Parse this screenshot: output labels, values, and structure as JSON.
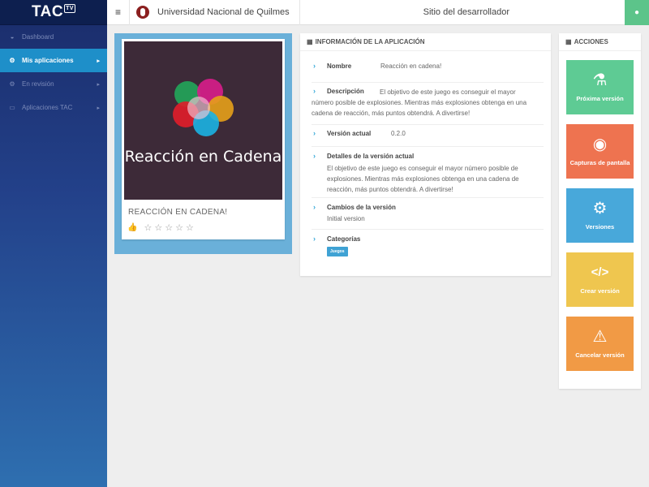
{
  "brand": {
    "name": "TAC",
    "badge": "TV"
  },
  "sidebar": {
    "items": [
      {
        "label": "Dashboard",
        "icon": "dashboard-icon",
        "glyph": "◒",
        "caret": ""
      },
      {
        "label": "Mis aplicaciones",
        "icon": "cogs-icon",
        "glyph": "⚙",
        "caret": "▸",
        "active": true
      },
      {
        "label": "En revisión",
        "icon": "cogs-icon",
        "glyph": "⚙",
        "caret": "▸"
      },
      {
        "label": "Aplicaciones TAC",
        "icon": "tv-icon",
        "glyph": "▭",
        "caret": "▸"
      }
    ]
  },
  "header": {
    "menu_glyph": "≡",
    "university": "Universidad Nacional de Quilmes",
    "site_title": "Sitio del desarrollador",
    "user_glyph": "●"
  },
  "app": {
    "image_title": "Reacción en Cadena",
    "name": "REACCIÓN EN CADENA!",
    "thumb_glyph": "👍",
    "stars": [
      "☆",
      "☆",
      "☆",
      "☆",
      "☆"
    ]
  },
  "info": {
    "heading": "INFORMACIÓN DE LA APLICACIÓN",
    "chevron": "›",
    "name_label": "Nombre",
    "name_value": "Reacción en cadena!",
    "desc_label": "Descripción",
    "desc_value": "El objetivo de este juego es conseguir el mayor número posible de explosiones. Mientras más explosiones obtenga en una cadena de reacción, más puntos obtendrá. A divertirse!",
    "version_label": "Versión actual",
    "version_value": "0.2.0",
    "details_label": "Detalles de la versión actual",
    "details_value": "El objetivo de este juego es conseguir el mayor número posible de explosiones. Mientras más explosiones obtenga en una cadena de reacción, más puntos obtendrá. A divertirse!",
    "changes_label": "Cambios de la versión",
    "changes_value": "Initial version",
    "categories_label": "Categorías",
    "category_tag": "Juegos"
  },
  "actions": {
    "heading": "ACCIONES",
    "grid_glyph": "▦",
    "items": [
      {
        "label": "Próxima versión",
        "icon": "flask-icon",
        "glyph": "⚗",
        "color": "#5ecb94"
      },
      {
        "label": "Capturas de pantalla",
        "icon": "camera-icon",
        "glyph": "◉",
        "color": "#ee7350"
      },
      {
        "label": "Versiones",
        "icon": "gear-icon",
        "glyph": "⚙",
        "color": "#48a8da"
      },
      {
        "label": "Crear versión",
        "icon": "code-icon",
        "glyph": "</>",
        "color": "#efc64f"
      },
      {
        "label": "Cancelar versión",
        "icon": "warning-icon",
        "glyph": "⚠",
        "color": "#f19a45"
      }
    ]
  }
}
